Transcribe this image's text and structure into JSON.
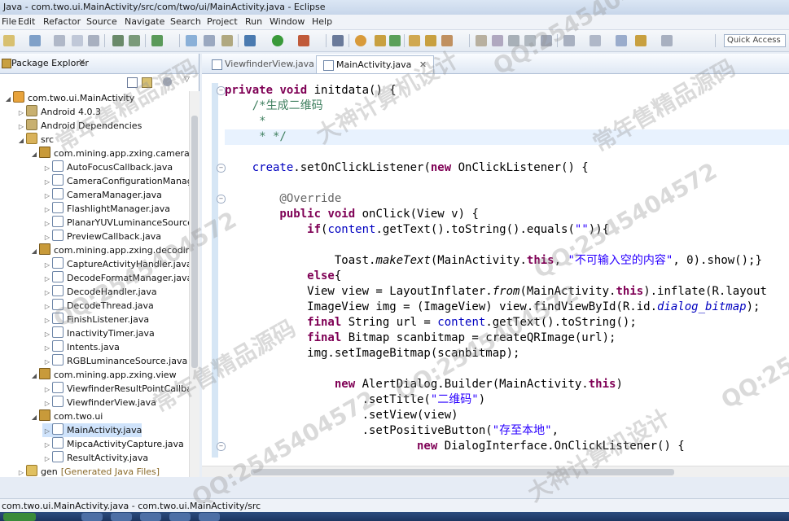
{
  "window": {
    "title": "Java - com.two.ui.MainActivity/src/com/two/ui/MainActivity.java - Eclipse"
  },
  "menu": [
    "File",
    "Edit",
    "Refactor",
    "Source",
    "Navigate",
    "Search",
    "Project",
    "Run",
    "Window",
    "Help"
  ],
  "quick_access": {
    "placeholder": "Quick Access"
  },
  "package_explorer": {
    "title": "Package Explorer",
    "close": "✕",
    "rows": [
      {
        "indent": 0,
        "arrow": "◢",
        "icon": "proj",
        "label": "com.two.ui.MainActivity"
      },
      {
        "indent": 1,
        "arrow": "▷",
        "icon": "lib",
        "label": "Android 4.0.3"
      },
      {
        "indent": 1,
        "arrow": "▷",
        "icon": "lib",
        "label": "Android Dependencies"
      },
      {
        "indent": 1,
        "arrow": "◢",
        "icon": "src",
        "label": "src"
      },
      {
        "indent": 2,
        "arrow": "◢",
        "icon": "pkg",
        "label": "com.mining.app.zxing.camera"
      },
      {
        "indent": 3,
        "arrow": "▷",
        "icon": "java",
        "label": "AutoFocusCallback.java"
      },
      {
        "indent": 3,
        "arrow": "▷",
        "icon": "java",
        "label": "CameraConfigurationManag"
      },
      {
        "indent": 3,
        "arrow": "▷",
        "icon": "java",
        "label": "CameraManager.java"
      },
      {
        "indent": 3,
        "arrow": "▷",
        "icon": "java",
        "label": "FlashlightManager.java"
      },
      {
        "indent": 3,
        "arrow": "▷",
        "icon": "java",
        "label": "PlanarYUVLuminanceSource."
      },
      {
        "indent": 3,
        "arrow": "▷",
        "icon": "java",
        "label": "PreviewCallback.java"
      },
      {
        "indent": 2,
        "arrow": "◢",
        "icon": "pkg",
        "label": "com.mining.app.zxing.decoding"
      },
      {
        "indent": 3,
        "arrow": "▷",
        "icon": "java",
        "label": "CaptureActivityHandler.java"
      },
      {
        "indent": 3,
        "arrow": "▷",
        "icon": "java",
        "label": "DecodeFormatManager.java"
      },
      {
        "indent": 3,
        "arrow": "▷",
        "icon": "java",
        "label": "DecodeHandler.java"
      },
      {
        "indent": 3,
        "arrow": "▷",
        "icon": "java",
        "label": "DecodeThread.java"
      },
      {
        "indent": 3,
        "arrow": "▷",
        "icon": "java",
        "label": "FinishListener.java"
      },
      {
        "indent": 3,
        "arrow": "▷",
        "icon": "java",
        "label": "InactivityTimer.java"
      },
      {
        "indent": 3,
        "arrow": "▷",
        "icon": "java",
        "label": "Intents.java"
      },
      {
        "indent": 3,
        "arrow": "▷",
        "icon": "java",
        "label": "RGBLuminanceSource.java"
      },
      {
        "indent": 2,
        "arrow": "◢",
        "icon": "pkg",
        "label": "com.mining.app.zxing.view"
      },
      {
        "indent": 3,
        "arrow": "▷",
        "icon": "java",
        "label": "ViewfinderResultPointCallbac"
      },
      {
        "indent": 3,
        "arrow": "▷",
        "icon": "java",
        "label": "ViewfinderView.java"
      },
      {
        "indent": 2,
        "arrow": "◢",
        "icon": "pkg",
        "label": "com.two.ui"
      },
      {
        "indent": 3,
        "arrow": "▷",
        "icon": "java",
        "label": "MainActivity.java",
        "selected": true
      },
      {
        "indent": 3,
        "arrow": "▷",
        "icon": "java",
        "label": "MipcaActivityCapture.java"
      },
      {
        "indent": 3,
        "arrow": "▷",
        "icon": "java",
        "label": "ResultActivity.java"
      },
      {
        "indent": 1,
        "arrow": "▷",
        "icon": "gen",
        "label": "gen",
        "suffix": "[Generated Java Files]"
      }
    ]
  },
  "editor": {
    "tabs": [
      {
        "label": "ViewfinderView.java",
        "active": false
      },
      {
        "label": "MainActivity.java",
        "active": true,
        "close": "✕"
      }
    ],
    "lines": [
      [
        {
          "t": "kw",
          "v": "private "
        },
        {
          "t": "kw",
          "v": "void "
        },
        {
          "t": "",
          "v": "initdata() {"
        }
      ],
      [
        {
          "t": "cm",
          "v": "    /*生成二维码"
        }
      ],
      [
        {
          "t": "cm",
          "v": "     *"
        }
      ],
      [
        {
          "t": "cm",
          "v": "     * */"
        }
      ],
      [],
      [
        {
          "t": "fld",
          "v": "    create"
        },
        {
          "t": "",
          "v": ".setOnClickListener("
        },
        {
          "t": "kw",
          "v": "new "
        },
        {
          "t": "",
          "v": "OnClickListener() {"
        }
      ],
      [],
      [
        {
          "t": "an",
          "v": "        @Override"
        }
      ],
      [
        {
          "t": "kw",
          "v": "        public "
        },
        {
          "t": "kw",
          "v": "void "
        },
        {
          "t": "",
          "v": "onClick(View v) {"
        }
      ],
      [
        {
          "t": "kw",
          "v": "            if"
        },
        {
          "t": "",
          "v": "("
        },
        {
          "t": "fld",
          "v": "content"
        },
        {
          "t": "",
          "v": ".getText().toString().equals("
        },
        {
          "t": "str",
          "v": "\"\""
        },
        {
          "t": "",
          "v": ")){"
        }
      ],
      [],
      [
        {
          "t": "",
          "v": "                Toast."
        },
        {
          "t": "it",
          "v": "makeText"
        },
        {
          "t": "",
          "v": "(MainActivity."
        },
        {
          "t": "kw",
          "v": "this"
        },
        {
          "t": "",
          "v": ", "
        },
        {
          "t": "str",
          "v": "\"不可输入空的内容\""
        },
        {
          "t": "",
          "v": ", 0).show();}"
        }
      ],
      [
        {
          "t": "kw",
          "v": "            else"
        },
        {
          "t": "",
          "v": "{"
        }
      ],
      [
        {
          "t": "",
          "v": "            View view = LayoutInflater."
        },
        {
          "t": "it",
          "v": "from"
        },
        {
          "t": "",
          "v": "(MainActivity."
        },
        {
          "t": "kw",
          "v": "this"
        },
        {
          "t": "",
          "v": ").inflate(R.layout"
        }
      ],
      [
        {
          "t": "",
          "v": "            ImageView img = (ImageView) view.findViewById(R.id."
        },
        {
          "t": "fld it",
          "v": "dialog_bitmap"
        },
        {
          "t": "",
          "v": ");"
        }
      ],
      [
        {
          "t": "kw",
          "v": "            final "
        },
        {
          "t": "",
          "v": "String url = "
        },
        {
          "t": "fld",
          "v": "content"
        },
        {
          "t": "",
          "v": ".getText().toString();"
        }
      ],
      [
        {
          "t": "kw",
          "v": "            final "
        },
        {
          "t": "",
          "v": "Bitmap scanbitmap = createQRImage(url);"
        }
      ],
      [
        {
          "t": "",
          "v": "            img.setImageBitmap(scanbitmap);"
        }
      ],
      [],
      [
        {
          "t": "kw",
          "v": "                new "
        },
        {
          "t": "",
          "v": "AlertDialog.Builder(MainActivity."
        },
        {
          "t": "kw",
          "v": "this"
        },
        {
          "t": "",
          "v": ")"
        }
      ],
      [
        {
          "t": "",
          "v": "                    .setTitle("
        },
        {
          "t": "str",
          "v": "\"二维码\""
        },
        {
          "t": "",
          "v": ")"
        }
      ],
      [
        {
          "t": "",
          "v": "                    .setView(view)"
        }
      ],
      [
        {
          "t": "",
          "v": "                    .setPositiveButton("
        },
        {
          "t": "str",
          "v": "\"存至本地\""
        },
        {
          "t": "",
          "v": ","
        }
      ],
      [
        {
          "t": "kw",
          "v": "                            new "
        },
        {
          "t": "",
          "v": "DialogInterface.OnClickListener() {"
        }
      ]
    ]
  },
  "status": {
    "text": "com.two.ui.MainActivity.java - com.two.ui.MainActivity/src"
  },
  "watermarks": [
    "QQ:2545404572",
    "常年售精品源码",
    "大神计算机设计"
  ]
}
